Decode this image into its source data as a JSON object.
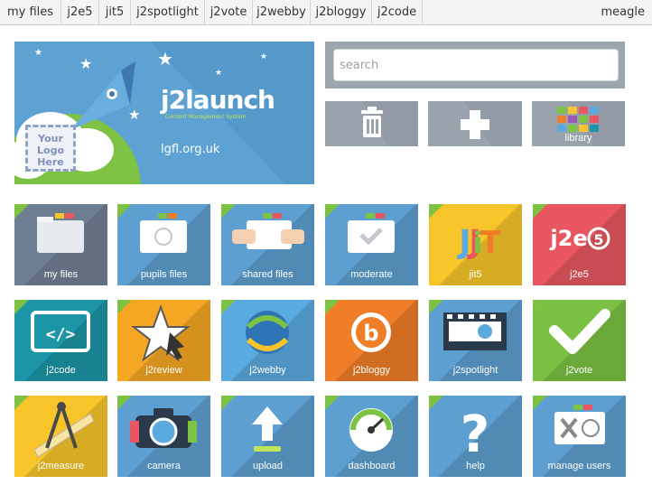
{
  "nav": {
    "items": [
      "my files",
      "j2e5",
      "jit5",
      "j2spotlight",
      "j2vote",
      "j2webby",
      "j2bloggy",
      "j2code"
    ],
    "user": "meagle"
  },
  "banner": {
    "logo_text": "Your Logo Here",
    "brand": "j2launch",
    "subtitle": "Content Management System",
    "url": "lgfl.org.uk"
  },
  "search": {
    "placeholder": "search"
  },
  "tools": {
    "library_label": "library"
  },
  "tiles": [
    {
      "label": "my files",
      "icon": "folder-icon",
      "color": "#6f7f93"
    },
    {
      "label": "pupils files",
      "icon": "smiley-folder-icon",
      "color": "#5c9fd0"
    },
    {
      "label": "shared files",
      "icon": "shared-folder-icon",
      "color": "#5c9fd0"
    },
    {
      "label": "moderate",
      "icon": "check-folder-icon",
      "color": "#5c9fd0"
    },
    {
      "label": "jit5",
      "icon": "jit5-logo-icon",
      "color": "#f7c52a"
    },
    {
      "label": "j2e5",
      "icon": "j2e5-logo-icon",
      "color": "#e8575f"
    },
    {
      "label": "j2code",
      "icon": "code-window-icon",
      "color": "#1c95a6"
    },
    {
      "label": "j2review",
      "icon": "star-cursor-icon",
      "color": "#f5a623"
    },
    {
      "label": "j2webby",
      "icon": "globe-swirl-icon",
      "color": "#5aa9df"
    },
    {
      "label": "j2bloggy",
      "icon": "bloggy-logo-icon",
      "color": "#f07d27"
    },
    {
      "label": "j2spotlight",
      "icon": "film-strip-icon",
      "color": "#5c9fd0"
    },
    {
      "label": "j2vote",
      "icon": "tick-icon",
      "color": "#7ac143"
    },
    {
      "label": "j2measure",
      "icon": "compass-ruler-icon",
      "color": "#f7c52a"
    },
    {
      "label": "camera",
      "icon": "camera-icon",
      "color": "#5c9fd0"
    },
    {
      "label": "upload",
      "icon": "upload-arrow-icon",
      "color": "#5c9fd0"
    },
    {
      "label": "dashboard",
      "icon": "speedometer-icon",
      "color": "#5c9fd0"
    },
    {
      "label": "help",
      "icon": "question-mark-icon",
      "color": "#5c9fd0"
    },
    {
      "label": "manage users",
      "icon": "tools-user-icon",
      "color": "#5c9fd0"
    }
  ]
}
